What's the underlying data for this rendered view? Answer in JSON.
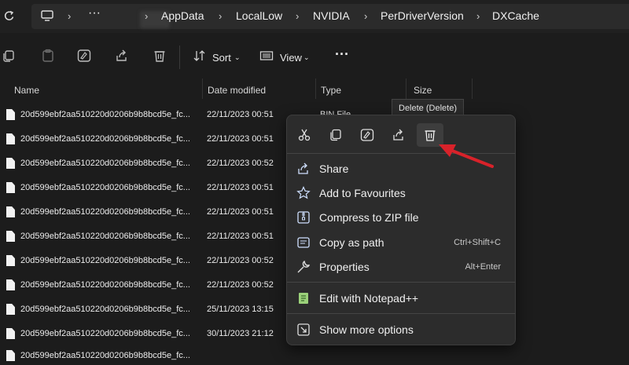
{
  "address": {
    "crumbs": [
      "AppData",
      "LocalLow",
      "NVIDIA",
      "PerDriverVersion",
      "DXCache"
    ],
    "overflow": "···"
  },
  "toolbar": {
    "sort_label": "Sort",
    "view_label": "View",
    "more": "···"
  },
  "columns": {
    "name": "Name",
    "date": "Date modified",
    "type": "Type",
    "size": "Size"
  },
  "files": [
    {
      "name": "20d599ebf2aa510220d0206b9b8bcd5e_fc...",
      "date": "22/11/2023 00:51",
      "type": "BIN File"
    },
    {
      "name": "20d599ebf2aa510220d0206b9b8bcd5e_fc...",
      "date": "22/11/2023 00:51",
      "type": ""
    },
    {
      "name": "20d599ebf2aa510220d0206b9b8bcd5e_fc...",
      "date": "22/11/2023 00:52",
      "type": ""
    },
    {
      "name": "20d599ebf2aa510220d0206b9b8bcd5e_fc...",
      "date": "22/11/2023 00:51",
      "type": ""
    },
    {
      "name": "20d599ebf2aa510220d0206b9b8bcd5e_fc...",
      "date": "22/11/2023 00:51",
      "type": ""
    },
    {
      "name": "20d599ebf2aa510220d0206b9b8bcd5e_fc...",
      "date": "22/11/2023 00:51",
      "type": ""
    },
    {
      "name": "20d599ebf2aa510220d0206b9b8bcd5e_fc...",
      "date": "22/11/2023 00:52",
      "type": ""
    },
    {
      "name": "20d599ebf2aa510220d0206b9b8bcd5e_fc...",
      "date": "22/11/2023 00:52",
      "type": ""
    },
    {
      "name": "20d599ebf2aa510220d0206b9b8bcd5e_fc...",
      "date": "25/11/2023 13:15",
      "type": ""
    },
    {
      "name": "20d599ebf2aa510220d0206b9b8bcd5e_fc...",
      "date": "30/11/2023 21:12",
      "type": ""
    },
    {
      "name": "20d599ebf2aa510220d0206b9b8bcd5e_fc...",
      "date": "",
      "type": ""
    }
  ],
  "tooltip": "Delete (Delete)",
  "context_menu": {
    "icons": [
      "cut-icon",
      "copy-icon",
      "rename-icon",
      "share-icon",
      "delete-icon"
    ],
    "items": [
      {
        "label": "Share",
        "shortcut": "",
        "icon": "share-icon"
      },
      {
        "label": "Add to Favourites",
        "shortcut": "",
        "icon": "star-icon"
      },
      {
        "label": "Compress to ZIP file",
        "shortcut": "",
        "icon": "zip-icon"
      },
      {
        "label": "Copy as path",
        "shortcut": "Ctrl+Shift+C",
        "icon": "path-icon"
      },
      {
        "label": "Properties",
        "shortcut": "Alt+Enter",
        "icon": "wrench-icon"
      },
      {
        "label": "Edit with Notepad++",
        "shortcut": "",
        "icon": "notepadpp-icon"
      },
      {
        "label": "Show more options",
        "shortcut": "",
        "icon": "more-options-icon"
      }
    ]
  },
  "colors": {
    "accent_arrow": "#d8222a",
    "background": "#1c1c1c",
    "menu": "#2c2c2c"
  }
}
